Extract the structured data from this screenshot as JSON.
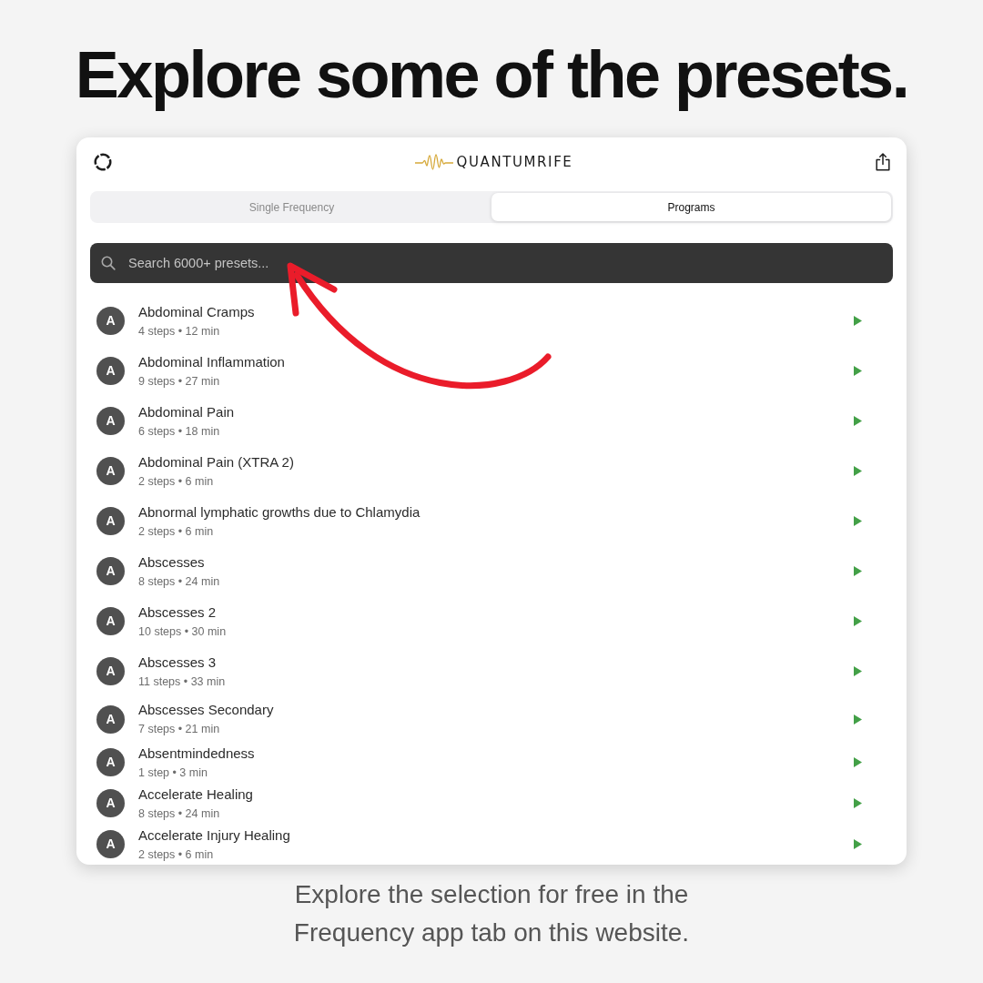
{
  "headline": "Explore some of the presets.",
  "app": {
    "brand": "QUANTUMRIFE",
    "tabs": [
      {
        "label": "Single Frequency",
        "selected": false
      },
      {
        "label": "Programs",
        "selected": true
      }
    ],
    "search": {
      "placeholder": "Search 6000+ presets..."
    },
    "presets": [
      {
        "initial": "A",
        "name": "Abdominal Cramps",
        "details": "4 steps • 12 min"
      },
      {
        "initial": "A",
        "name": "Abdominal Inflammation",
        "details": "9 steps • 27 min"
      },
      {
        "initial": "A",
        "name": "Abdominal Pain",
        "details": "6 steps • 18 min"
      },
      {
        "initial": "A",
        "name": "Abdominal Pain (XTRA 2)",
        "details": "2 steps • 6 min"
      },
      {
        "initial": "A",
        "name": "Abnormal lymphatic growths due to Chlamydia",
        "details": "2 steps • 6 min"
      },
      {
        "initial": "A",
        "name": "Abscesses",
        "details": "8 steps • 24 min"
      },
      {
        "initial": "A",
        "name": "Abscesses 2",
        "details": "10 steps • 30 min"
      },
      {
        "initial": "A",
        "name": "Abscesses 3",
        "details": "11 steps • 33 min"
      },
      {
        "initial": "A",
        "name": "Abscesses Secondary",
        "details": "7 steps • 21 min"
      },
      {
        "initial": "A",
        "name": "Absentmindedness",
        "details": "1 step • 3 min"
      },
      {
        "initial": "A",
        "name": "Accelerate Healing",
        "details": "8 steps • 24 min"
      },
      {
        "initial": "A",
        "name": "Accelerate Injury Healing",
        "details": "2 steps • 6 min"
      }
    ]
  },
  "caption": "Explore the selection for free in the Frequency app tab on this website."
}
